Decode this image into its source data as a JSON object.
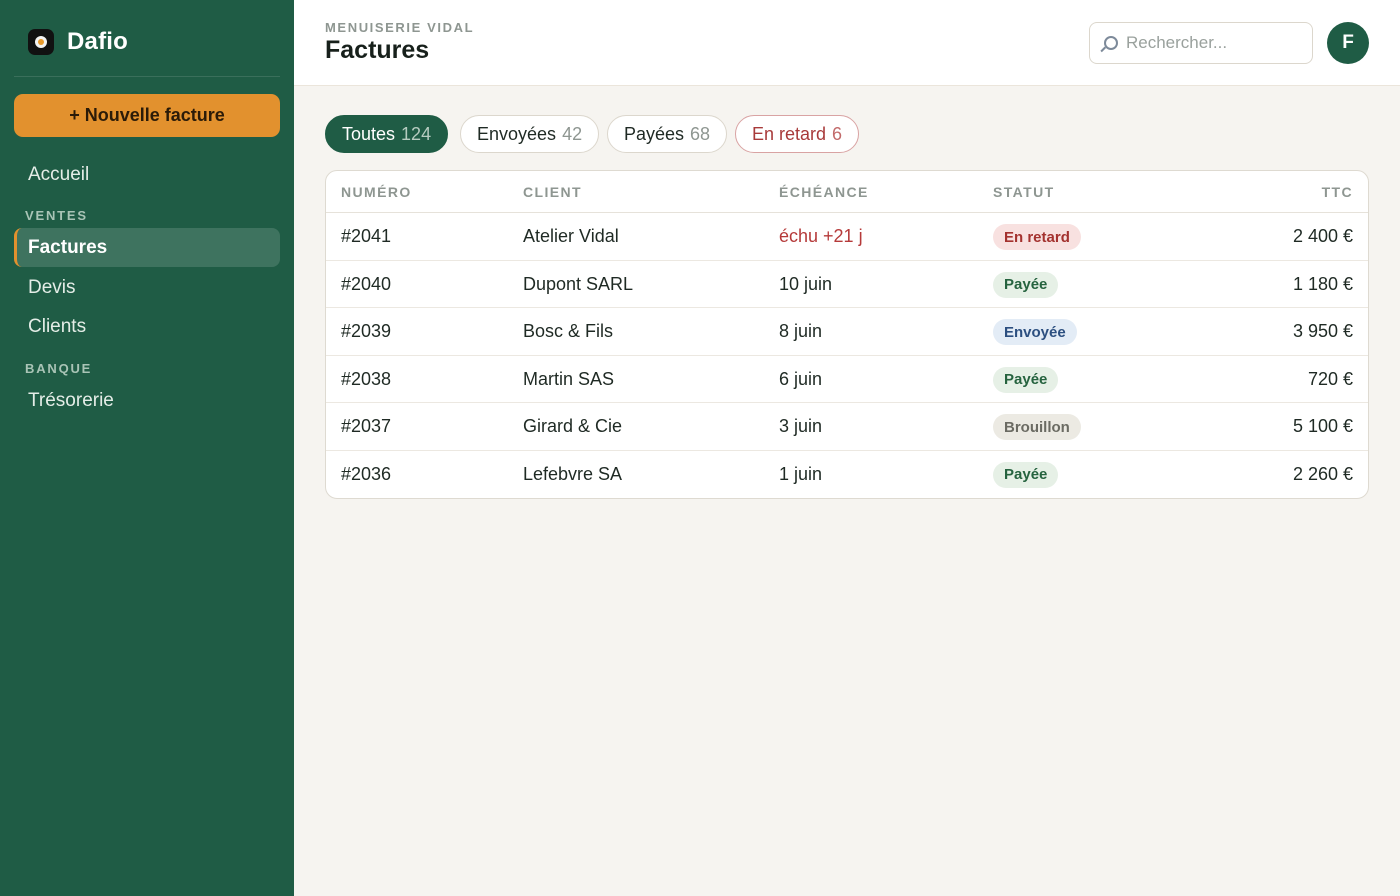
{
  "brand": {
    "name": "Dafio",
    "logo_icon": "dafio-logo-icon"
  },
  "sidebar": {
    "new_button": "+ Nouvelle facture",
    "home": "Accueil",
    "sections": [
      {
        "label": "VENTES",
        "items": [
          "Factures",
          "Devis",
          "Clients"
        ]
      },
      {
        "label": "BANQUE",
        "items": [
          "Trésorerie"
        ]
      }
    ],
    "active_item": "Factures"
  },
  "header": {
    "organization": "MENUISERIE VIDAL",
    "title": "Factures",
    "search_placeholder": "Rechercher...",
    "avatar_initial": "F"
  },
  "tabs": [
    {
      "label": "Toutes",
      "count": "124",
      "state": "active"
    },
    {
      "label": "Envoyées",
      "count": "42",
      "state": "normal"
    },
    {
      "label": "Payées",
      "count": "68",
      "state": "normal"
    },
    {
      "label": "En retard",
      "count": "6",
      "state": "late"
    }
  ],
  "table": {
    "columns": [
      "NUMÉRO",
      "CLIENT",
      "ÉCHÉANCE",
      "STATUT",
      "TTC"
    ],
    "rows": [
      {
        "number": "#2041",
        "client": "Atelier Vidal",
        "due": "échu +21 j",
        "due_late": true,
        "status": "En retard",
        "status_kind": "retard",
        "amount": "2 400 €"
      },
      {
        "number": "#2040",
        "client": "Dupont SARL",
        "due": "10 juin",
        "due_late": false,
        "status": "Payée",
        "status_kind": "payee",
        "amount": "1 180 €"
      },
      {
        "number": "#2039",
        "client": "Bosc & Fils",
        "due": "8 juin",
        "due_late": false,
        "status": "Envoyée",
        "status_kind": "envoyee",
        "amount": "3 950 €"
      },
      {
        "number": "#2038",
        "client": "Martin SAS",
        "due": "6 juin",
        "due_late": false,
        "status": "Payée",
        "status_kind": "payee",
        "amount": "720 €"
      },
      {
        "number": "#2037",
        "client": "Girard & Cie",
        "due": "3 juin",
        "due_late": false,
        "status": "Brouillon",
        "status_kind": "brouillon",
        "amount": "5 100 €"
      },
      {
        "number": "#2036",
        "client": "Lefebvre SA",
        "due": "1 juin",
        "due_late": false,
        "status": "Payée",
        "status_kind": "payee",
        "amount": "2 260 €"
      }
    ]
  },
  "colors": {
    "sidebar_bg": "#1f5c45",
    "accent_orange": "#e2912e",
    "late_red": "#b53a3a",
    "paid_green": "#26633f",
    "sent_blue": "#2c4f80"
  }
}
